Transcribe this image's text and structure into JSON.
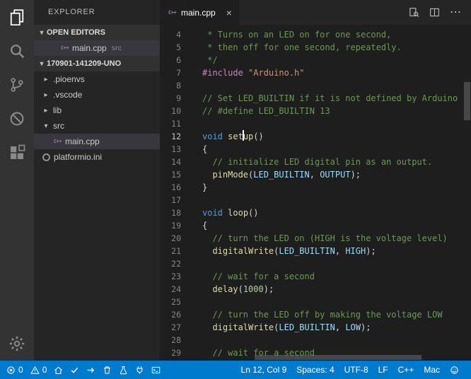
{
  "colors": {
    "status_bar": "#007acc",
    "activity_bar": "#333333",
    "sidebar": "#252526",
    "editor": "#1e1e1e",
    "selection_row": "#37373d",
    "syntax": {
      "c": "#6a9955",
      "k": "#569cd6",
      "p": "#c586c0",
      "s": "#ce9178",
      "f": "#dcdcaa",
      "v": "#9cdcfe",
      "n": "#b5cea8",
      "d": "#d4d4d4"
    }
  },
  "activity_bar": {
    "items": [
      {
        "icon": "files",
        "name": "explorer",
        "active": true
      },
      {
        "icon": "search",
        "name": "search",
        "active": false
      },
      {
        "icon": "source-control",
        "name": "source-control",
        "active": false
      },
      {
        "icon": "debug",
        "name": "debug",
        "active": false
      },
      {
        "icon": "extensions",
        "name": "extensions",
        "active": false
      }
    ],
    "bottom_items": [
      {
        "icon": "gear",
        "name": "settings",
        "active": false
      }
    ]
  },
  "sidebar": {
    "title": "EXPLORER",
    "open_editors": {
      "header": "OPEN EDITORS",
      "expanded": true,
      "items": [
        {
          "label": "main.cpp",
          "detail": "src",
          "icon": "cpp",
          "selected": true
        }
      ]
    },
    "workspace": {
      "header": "170901-141209-UNO",
      "expanded": true,
      "tree": [
        {
          "label": ".pioenvs",
          "kind": "folder",
          "expanded": false,
          "level": 0
        },
        {
          "label": ".vscode",
          "kind": "folder",
          "expanded": false,
          "level": 0
        },
        {
          "label": "lib",
          "kind": "folder",
          "expanded": false,
          "level": 0
        },
        {
          "label": "src",
          "kind": "folder",
          "expanded": true,
          "level": 0
        },
        {
          "label": "main.cpp",
          "kind": "file",
          "icon": "cpp",
          "level": 1,
          "selected": true
        },
        {
          "label": "platformio.ini",
          "kind": "file",
          "icon": "ini",
          "level": 0
        }
      ]
    }
  },
  "editor": {
    "tabs": [
      {
        "label": "main.cpp",
        "icon": "cpp",
        "active": true
      }
    ],
    "actions": [
      {
        "icon": "open-changes",
        "name": "open-changes"
      },
      {
        "icon": "split-editor",
        "name": "split-editor"
      },
      {
        "icon": "more",
        "name": "more-actions"
      }
    ],
    "cursor": {
      "line": 12,
      "col": 9
    },
    "code": {
      "first_line_number": 4,
      "lines": [
        [
          [
            "c",
            " * Turns on an LED on for one second,"
          ]
        ],
        [
          [
            "c",
            " * then off for one second, repeatedly."
          ]
        ],
        [
          [
            "c",
            " */"
          ]
        ],
        [
          [
            "p",
            "#include"
          ],
          [
            "d",
            " "
          ],
          [
            "s",
            "\"Arduino.h\""
          ]
        ],
        [],
        [
          [
            "c",
            "// Set LED_BUILTIN if it is not defined by Arduino"
          ]
        ],
        [
          [
            "c",
            "// #define LED_BUILTIN 13"
          ]
        ],
        [],
        [
          [
            "k",
            "void"
          ],
          [
            "d",
            " "
          ],
          [
            "f",
            "set"
          ],
          [
            "caret",
            ""
          ],
          [
            "f",
            "up"
          ],
          [
            "d",
            "()"
          ]
        ],
        [
          [
            "d",
            "{"
          ]
        ],
        [
          [
            "c",
            "  // initialize LED digital pin as an output."
          ]
        ],
        [
          [
            "d",
            "  "
          ],
          [
            "f",
            "pinMode"
          ],
          [
            "d",
            "("
          ],
          [
            "v",
            "LED_BUILTIN"
          ],
          [
            "d",
            ", "
          ],
          [
            "v",
            "OUTPUT"
          ],
          [
            "d",
            ");"
          ]
        ],
        [
          [
            "d",
            "}"
          ]
        ],
        [],
        [
          [
            "k",
            "void"
          ],
          [
            "d",
            " "
          ],
          [
            "f",
            "loop"
          ],
          [
            "d",
            "()"
          ]
        ],
        [
          [
            "d",
            "{"
          ]
        ],
        [
          [
            "c",
            "  // turn the LED on (HIGH is the voltage level)"
          ]
        ],
        [
          [
            "d",
            "  "
          ],
          [
            "f",
            "digitalWrite"
          ],
          [
            "d",
            "("
          ],
          [
            "v",
            "LED_BUILTIN"
          ],
          [
            "d",
            ", "
          ],
          [
            "v",
            "HIGH"
          ],
          [
            "d",
            ");"
          ]
        ],
        [],
        [
          [
            "c",
            "  // wait for a second"
          ]
        ],
        [
          [
            "d",
            "  "
          ],
          [
            "f",
            "delay"
          ],
          [
            "d",
            "("
          ],
          [
            "n",
            "1000"
          ],
          [
            "d",
            ");"
          ]
        ],
        [],
        [
          [
            "c",
            "  // turn the LED off by making the voltage LOW"
          ]
        ],
        [
          [
            "d",
            "  "
          ],
          [
            "f",
            "digitalWrite"
          ],
          [
            "d",
            "("
          ],
          [
            "v",
            "LED_BUILTIN"
          ],
          [
            "d",
            ", "
          ],
          [
            "v",
            "LOW"
          ],
          [
            "d",
            ");"
          ]
        ],
        [],
        [
          [
            "c",
            "  // wait for a second"
          ]
        ]
      ]
    }
  },
  "status_bar": {
    "left": [
      {
        "icon": "error",
        "label": "0",
        "name": "problems-errors"
      },
      {
        "icon": "warning",
        "label": "0",
        "name": "problems-warnings"
      },
      {
        "icon": "home",
        "name": "pio-home"
      },
      {
        "icon": "check",
        "name": "pio-build"
      },
      {
        "icon": "arrow-right",
        "name": "pio-upload"
      },
      {
        "icon": "trash",
        "name": "pio-clean"
      },
      {
        "icon": "flask",
        "name": "pio-test"
      },
      {
        "icon": "plug",
        "name": "pio-serial-monitor"
      },
      {
        "icon": "terminal",
        "name": "pio-terminal"
      }
    ],
    "right": [
      {
        "label": "Ln 12, Col 9",
        "name": "cursor-position"
      },
      {
        "label": "Spaces: 4",
        "name": "indentation"
      },
      {
        "label": "UTF-8",
        "name": "encoding"
      },
      {
        "label": "LF",
        "name": "end-of-line"
      },
      {
        "label": "C++",
        "name": "language-mode"
      },
      {
        "label": "Mac",
        "name": "keymap"
      },
      {
        "icon": "smiley",
        "name": "feedback"
      }
    ]
  }
}
